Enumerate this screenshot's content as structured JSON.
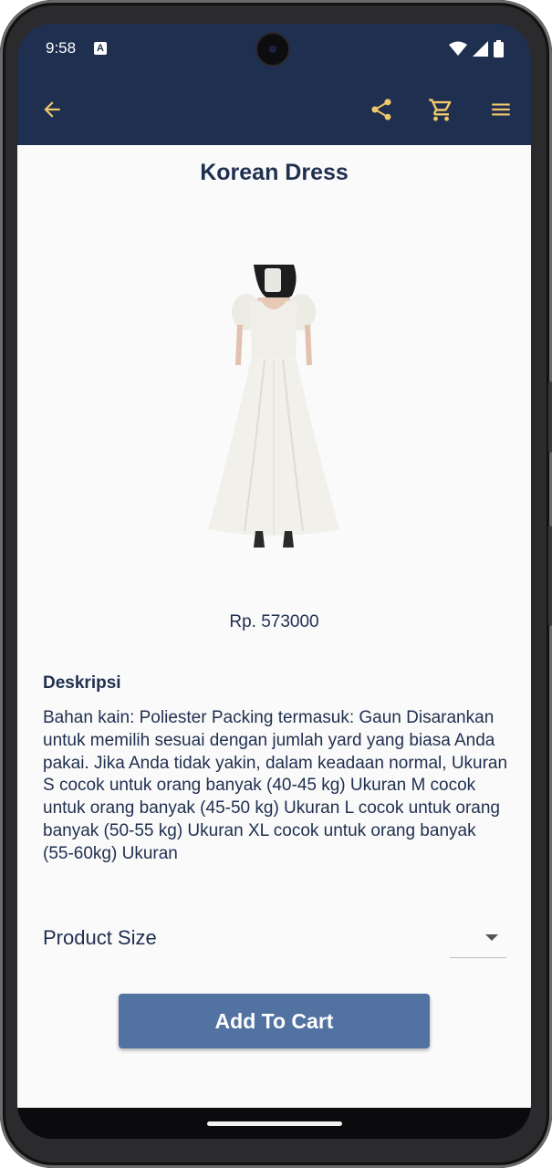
{
  "status_bar": {
    "time": "9:58",
    "notification_icon": "a-box-icon",
    "icons": [
      "wifi-icon",
      "signal-icon",
      "battery-icon"
    ]
  },
  "toolbar": {
    "back_icon": "arrow-left-icon",
    "share_icon": "share-icon",
    "cart_icon": "cart-icon",
    "menu_icon": "hamburger-menu-icon",
    "icon_color": "#f0c86a",
    "background": "#1f2f4f"
  },
  "product": {
    "title": "Korean Dress",
    "image": "white-dress-photo",
    "price": "Rp. 573000"
  },
  "description": {
    "heading": "Deskripsi",
    "text": "Bahan kain: Poliester Packing termasuk: Gaun Disarankan untuk memilih sesuai dengan jumlah yard yang biasa Anda pakai. Jika Anda tidak yakin, dalam keadaan normal, Ukuran S cocok untuk orang banyak (40-45 kg) Ukuran M cocok untuk orang banyak (45-50 kg) Ukuran L cocok untuk orang banyak (50-55 kg) Ukuran XL cocok untuk orang banyak (55-60kg) Ukuran"
  },
  "size_selector": {
    "label": "Product Size",
    "selected": ""
  },
  "actions": {
    "add_to_cart_label": "Add To Cart",
    "button_color": "#5272a2"
  }
}
